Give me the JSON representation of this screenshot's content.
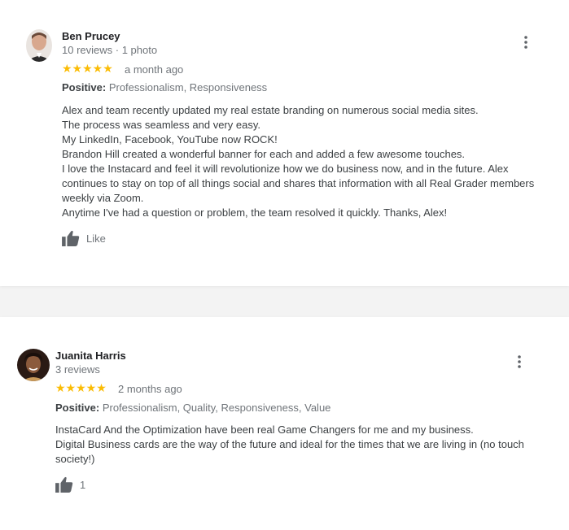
{
  "reviews": [
    {
      "name": "Ben Prucey",
      "meta": "10 reviews · 1 photo",
      "stars": "★★★★★",
      "when": "a month ago",
      "positive_label": "Positive:",
      "positive_values": "Professionalism, Responsiveness",
      "text": "Alex and team recently updated my real estate branding on numerous social media sites.\nThe process was seamless and very easy.\nMy LinkedIn, Facebook, YouTube now ROCK!\nBrandon Hill created a wonderful banner for each and added a few awesome touches.\nI love the Instacard and feel it will revolutionize how we do business now, and in the future.  Alex continues to stay on top of all things social and shares that information with all Real Grader members weekly via Zoom.\nAnytime I've had a question or problem, the team resolved it quickly.  Thanks, Alex!",
      "like_label": "Like"
    },
    {
      "name": "Juanita Harris",
      "meta": "3 reviews",
      "stars": "★★★★★",
      "when": "2 months ago",
      "positive_label": "Positive:",
      "positive_values": "Professionalism, Quality, Responsiveness, Value",
      "text": "InstaCard And the Optimization have been real Game Changers for me and my business.\nDigital Business cards are the way of the future and ideal for the times that we are living in (no touch society!)",
      "like_label": "1"
    }
  ],
  "colors": {
    "star": "#fbbc04",
    "muted": "#70757a",
    "text": "#3c4043"
  },
  "icons": [
    "avatar",
    "star-icon",
    "thumbs-up-icon",
    "more-vert-icon"
  ]
}
